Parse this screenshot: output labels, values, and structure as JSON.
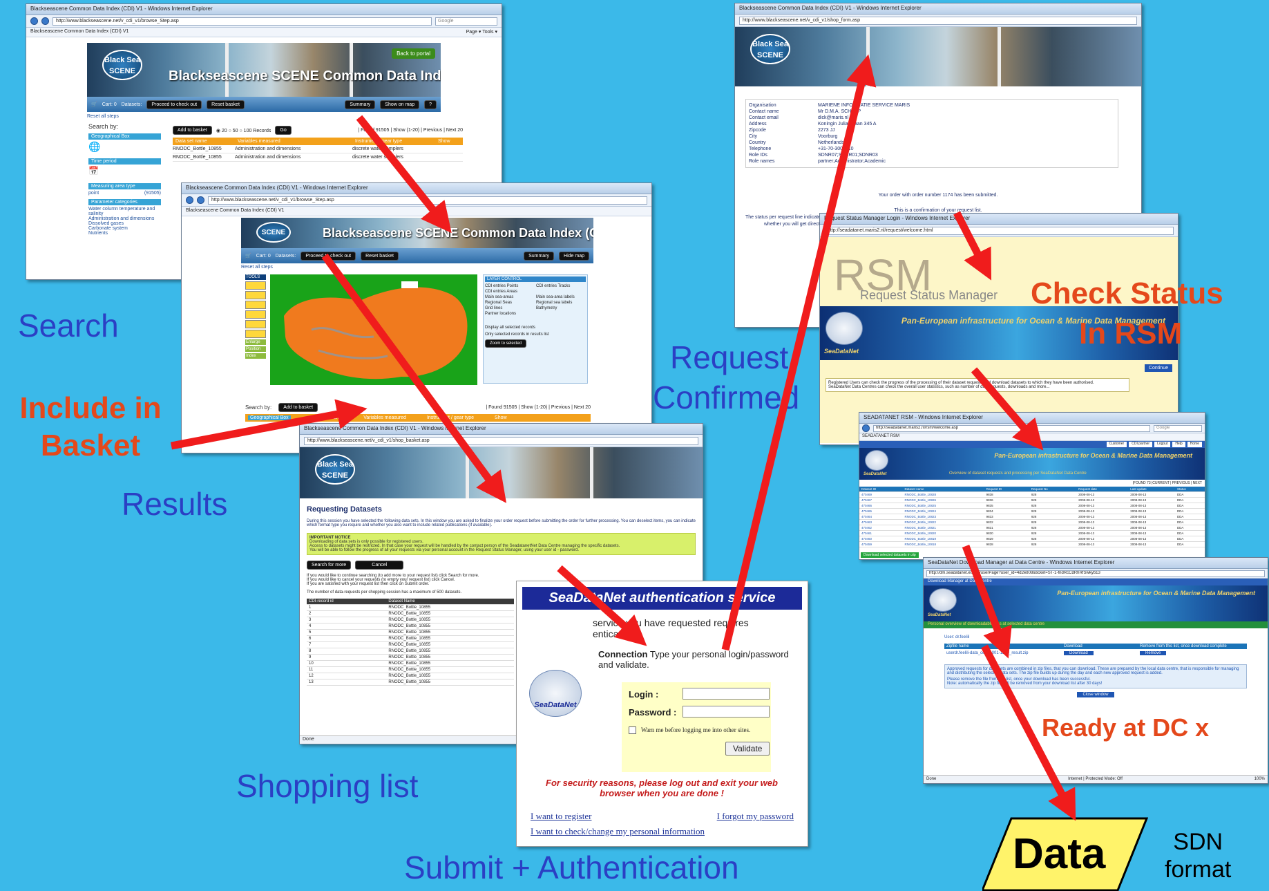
{
  "labels": {
    "search": "Search",
    "results": "Results",
    "shopping": "Shopping list",
    "submit": "Submit + Authentication",
    "request_confirmed_1": "Request",
    "request_confirmed_2": "Confirmed",
    "include_1": "Include in",
    "include_2": "Basket",
    "check_1": "Check Status",
    "check_2": "In RSM",
    "ready": "Ready at DC x",
    "data": "Data",
    "sdn_1": "SDN",
    "sdn_2": "format"
  },
  "colors": {
    "background": "#3bb9e9",
    "arrow": "#f01c1c",
    "blue_label": "#2b3fc4",
    "red_label": "#e4481b",
    "data_box": "#fff36a"
  },
  "search_window": {
    "title": "Blackseascene Common Data Index (CDI) V1 - Windows Internet Explorer",
    "url": "http://www.blackseascene.net/v_cdi_v1/browse_Step.asp",
    "search_box": "Google",
    "tab": "Blackseascene Common Data Index (CDI) V1",
    "page_menu": "Page ▾ Tools ▾",
    "logo": "Black Sea SCENE",
    "banner_title": "Blackseascene SCENE Common Data Index (CDI) V1",
    "back_to_portal": "Back to portal",
    "cart": "Cart: 0",
    "datasets": "Datasets:",
    "btn_checkout": "Proceed to check out",
    "btn_reset": "Reset basket",
    "btn_summary": "Summary",
    "btn_show_map": "Show on map",
    "btn_help": "?",
    "reset_steps": "Reset all steps",
    "search_by": "Search by:",
    "add_to_basket": "Add to basket",
    "records_opts": "◉ 20  ○ 50  ○ 100 Records",
    "go": "Go",
    "found": "| Found 91505 | Show (1-20) | Previous | Next 20",
    "col_name": "Data set name",
    "col_vars": "Variables measured",
    "col_instr": "Instrument / gear type",
    "col_show": "Show",
    "rows": [
      {
        "name": "RNODC_Bottle_10855",
        "vars": "Administration and dimensions",
        "instr": "discrete water samplers"
      },
      {
        "name": "RNODC_Bottle_10855",
        "vars": "Administration and dimensions",
        "instr": "discrete water samplers"
      }
    ],
    "side_geo": "Geographical Box",
    "side_time": "Time period",
    "side_area": "Measuring area type",
    "side_point": "point",
    "side_point_n": "(91505)",
    "side_param": "Parameter categories",
    "side_params": [
      "Water column temperature and salinity",
      "Administration and dimensions",
      "Dissolved gases",
      "Carbonate system",
      "Nutrients"
    ]
  },
  "results_window": {
    "title": "Blackseascene Common Data Index (CDI) V1 - Windows Internet Explorer",
    "url": "http://www.blackseascene.net/v_cdi_v1/browse_Step.asp",
    "tab": "Blackseascene Common Data Index (CDI) V1",
    "logo": "SCENE",
    "banner_title": "Blackseascene SCENE Common Data Index (CDI) V1",
    "cart": "Cart: 0",
    "datasets": "Datasets:",
    "btn_checkout": "Proceed to check out",
    "btn_reset": "Reset basket",
    "btn_summary": "Summary",
    "btn_hide_map": "Hide map",
    "reset_steps": "Reset all steps",
    "tools": "TOOLS",
    "tool_enlarge": "Enlarge",
    "tool_position": "Position",
    "tool_index": "Index",
    "layer_control": "LAYER CONTROL",
    "layers": [
      "CDI entries Points",
      "CDI entries Tracks",
      "CDI entries Areas",
      "Main sea-areas",
      "Main sea-area labels",
      "Regional Seas",
      "Regional sea labels",
      "Grid lines",
      "Bathymetry",
      "Partner locations"
    ],
    "display_all": "Display all selected records",
    "only_selected": "Only selected records in results list",
    "zoom_selected": "Zoom to selected",
    "search_by": "Search by:",
    "add_to_basket": "Add to basket",
    "found": "| Found 91505 | Show (1-20) | Previous | Next 20",
    "geo_box": "Geographical Box",
    "col_name": "Data set name",
    "col_vars": "Variables measured",
    "col_instr": "Instrument / gear type",
    "col_show": "Show"
  },
  "basket_window": {
    "title": "Blackseascene Common Data Index (CDI) V1 - Windows Internet Explorer",
    "url": "http://www.blackseascene.net/v_cdi_v1/shop_basket.asp",
    "logo": "Black Sea SCENE",
    "heading": "Requesting Datasets",
    "intro": "During this session you have selected the following data sets. In this window you are asked to finalize your order request before submitting the order for further processing. You can deselect items, you can indicate which format type you require and whether you also want to include related publications (if available).",
    "notice_title": "IMPORTANT NOTICE",
    "notice_1": "Downloading of data sets is only possible for registered users.",
    "notice_2": "Access to datasets might be restricted. In that case your request will be handled by the contact person of the SeadatanetNet Data Centre managing the specific datasets.",
    "notice_3": "You will be able to follow the progress of all your requests via your personal account in the Request Status Manager, using your user id - password.",
    "btn_more": "Search for more",
    "btn_cancel": "Cancel",
    "instr_1": "If you would like to continue searching (to add more to your request list) click Search for more.",
    "instr_2": "If you would like to cancel your requests (to empty your request list) click Cancel.",
    "instr_3": "If you are satisfied with your request list then click on Submit order.",
    "max_note": "The number of data-requests per shopping session has a maximum of 500 datasets.",
    "col_id": "CDI-record id",
    "col_name": "Dataset Name",
    "rows": [
      {
        "id": "1",
        "name": "RNODC_Bottle_10855"
      },
      {
        "id": "2",
        "name": "RNODC_Bottle_10855"
      },
      {
        "id": "3",
        "name": "RNODC_Bottle_10855"
      },
      {
        "id": "4",
        "name": "RNODC_Bottle_10855"
      },
      {
        "id": "5",
        "name": "RNODC_Bottle_10855"
      },
      {
        "id": "6",
        "name": "RNODC_Bottle_10855"
      },
      {
        "id": "7",
        "name": "RNODC_Bottle_10855"
      },
      {
        "id": "8",
        "name": "RNODC_Bottle_10855"
      },
      {
        "id": "9",
        "name": "RNODC_Bottle_10855"
      },
      {
        "id": "10",
        "name": "RNODC_Bottle_10855"
      },
      {
        "id": "11",
        "name": "RNODC_Bottle_10855"
      },
      {
        "id": "12",
        "name": "RNODC_Bottle_10855"
      },
      {
        "id": "13",
        "name": "RNODC_Bottle_10855"
      }
    ],
    "status": "Done"
  },
  "auth_window": {
    "header": "SeaDataNet authentication service",
    "service_1": "service you have requested requires",
    "service_2": "entication",
    "connection_bold": "Connection",
    "connection_text": " Type your personal login/password and validate.",
    "login_label": "Login :",
    "password_label": "Password :",
    "warn": "Warn me before logging me into other sites.",
    "validate": "Validate",
    "logo": "SeaDataNet",
    "security": "For security reasons, please log out and exit your web browser when you are done !",
    "register": "I want to register",
    "forgot": "I forgot my password",
    "change": "I want to check/change my personal information"
  },
  "shop_form_window": {
    "title": "Blackseascene Common Data Index (CDI) V1 - Windows Internet Explorer",
    "url": "http://www.blackseascene.net/v_cdi_v1/shop_form.asp",
    "logo": "Black Sea SCENE",
    "fields": [
      {
        "k": "Organisation",
        "v": "MARIENE INFORMATIE SERVICE MARIS"
      },
      {
        "k": "Contact name",
        "v": "Mr D.M.A. SCHAAP"
      },
      {
        "k": "Contact email",
        "v": "dick@maris.nl"
      },
      {
        "k": "Address",
        "v": "Koningin Julianalaan 345 A"
      },
      {
        "k": "Zipcode",
        "v": "2273 JJ"
      },
      {
        "k": "City",
        "v": "Voorburg"
      },
      {
        "k": "Country",
        "v": "Netherlands"
      },
      {
        "k": "Telephone",
        "v": "+31-70-3004710"
      },
      {
        "k": "Role IDs",
        "v": "SDNR07;SDNR01;SDNR03"
      },
      {
        "k": "Role names",
        "v": "partner;Administrator;Academic"
      }
    ],
    "order_msg_1": "Your order with order number 1174 has been submitted.",
    "order_msg_2": "This is a confirmation of your request list.",
    "status_note_1": "The status per request line indicate",
    "status_note_2": "whether you will get direct"
  },
  "rsm_login_window": {
    "title": "Request Status Manager Login - Windows Internet Explorer",
    "url": "http://seadatanet.maris2.nl/request/welcome.html",
    "rsm": "RSM",
    "rsm_sub": "Request Status Manager",
    "pan_eu": "Pan-European infrastructure for Ocean & Marine Data Management",
    "logo": "SeaDataNet",
    "continue": "Continue",
    "info_1": "Registered Users can check the progress of the processing of their dataset requests and download datasets to which they have been authorised.",
    "info_2": "SeaDataNet Data Centres can check the overall user statistics, such as number of data requests, downloads and more..."
  },
  "rsm_list_window": {
    "title": "SEADATANET RSM - Windows Internet Explorer",
    "url": "http://seadatanet.maris2.nl/rsm/welcome.asp",
    "search": "Google",
    "tab": "SEADATANET RSM",
    "tabs": [
      "Customer",
      "CDI partner",
      "Logout",
      "Help",
      "Home"
    ],
    "pan_eu": "Pan-European infrastructure for Ocean & Marine Data Management",
    "logo": "SeaDataNet",
    "overview": "Overview of dataset requests and processing per SeaDataNet Data Centre",
    "pager": "|FOUND 73 |CURRENT | PREVIOUS | NEXT",
    "columns": [
      "Dataset ID",
      "Dataset name",
      "Request ID",
      "Request No",
      "Request date",
      "Last update",
      "Status"
    ],
    "rows": [
      {
        "a": "470469",
        "b": "RNODC_Bottle_10828",
        "c": "9838",
        "d": "928",
        "e": "2008-08-13",
        "f": "2008-08-13",
        "g": "DDA"
      },
      {
        "a": "470467",
        "b": "RNODC_Bottle_10826",
        "c": "9836",
        "d": "928",
        "e": "2008-08-13",
        "f": "2008-08-13",
        "g": "DDA"
      },
      {
        "a": "470466",
        "b": "RNODC_Bottle_10825",
        "c": "9835",
        "d": "928",
        "e": "2008-08-13",
        "f": "2008-08-13",
        "g": "DDA"
      },
      {
        "a": "470465",
        "b": "RNODC_Bottle_10824",
        "c": "9834",
        "d": "928",
        "e": "2008-08-13",
        "f": "2008-08-13",
        "g": "DDA"
      },
      {
        "a": "470464",
        "b": "RNODC_Bottle_10823",
        "c": "9833",
        "d": "928",
        "e": "2008-08-13",
        "f": "2008-08-13",
        "g": "DDA"
      },
      {
        "a": "470463",
        "b": "RNODC_Bottle_10822",
        "c": "9832",
        "d": "928",
        "e": "2008-08-13",
        "f": "2008-08-13",
        "g": "DDA"
      },
      {
        "a": "470462",
        "b": "RNODC_Bottle_10821",
        "c": "9831",
        "d": "928",
        "e": "2008-08-13",
        "f": "2008-08-13",
        "g": "DDA"
      },
      {
        "a": "470461",
        "b": "RNODC_Bottle_10820",
        "c": "9830",
        "d": "928",
        "e": "2008-08-13",
        "f": "2008-08-13",
        "g": "DDA"
      },
      {
        "a": "470460",
        "b": "RNODC_Bottle_10819",
        "c": "9829",
        "d": "928",
        "e": "2008-08-13",
        "f": "2008-08-13",
        "g": "DDA"
      },
      {
        "a": "470459",
        "b": "RNODC_Bottle_10818",
        "c": "9828",
        "d": "928",
        "e": "2008-08-13",
        "f": "2008-08-13",
        "g": "DDA"
      }
    ],
    "download_btn": "Download selected datasets in zip"
  },
  "download_window": {
    "title": "SeaDataNet Download Manager at Data Centre - Windows Internet Explorer",
    "url": "http://dm.seadatanet.eu/dm/userPage?user_id=4d2e808&ticket=ST-1-fndRcCdRhRfSwkyb13",
    "breadcrumb": "Download Manager at Data Centre",
    "pan_eu": "Pan-European infrastructure for Ocean & Marine Data Management",
    "logo": "SeaDataNet",
    "subtitle": "Personal overview of downloadable files at selected data centre",
    "user": "User: dr.feelili",
    "col_zip": "Zipfile name",
    "col_dl": "Download",
    "col_rm": "Remove from this list, once download complete",
    "zip_name": "userdr.feelili-data_centre001-1209_result.zip",
    "download": "Download",
    "remove": "Remove",
    "note_1": "Approved requests for data sets are combined in zip files, that you can download. These are prepared by the local data centre, that is responsible for managing and distributing the selected data sets. The zip file builds up during the day and each new approved request is added.",
    "note_2": "Please remove the file from this list, once your download has been successful.",
    "note_3": "Note: automatically the zip file will be removed from your download list after 30 days!",
    "close": "Close window",
    "status": "Done",
    "zone": "Internet | Protected Mode: Off",
    "zoom": "100%"
  }
}
